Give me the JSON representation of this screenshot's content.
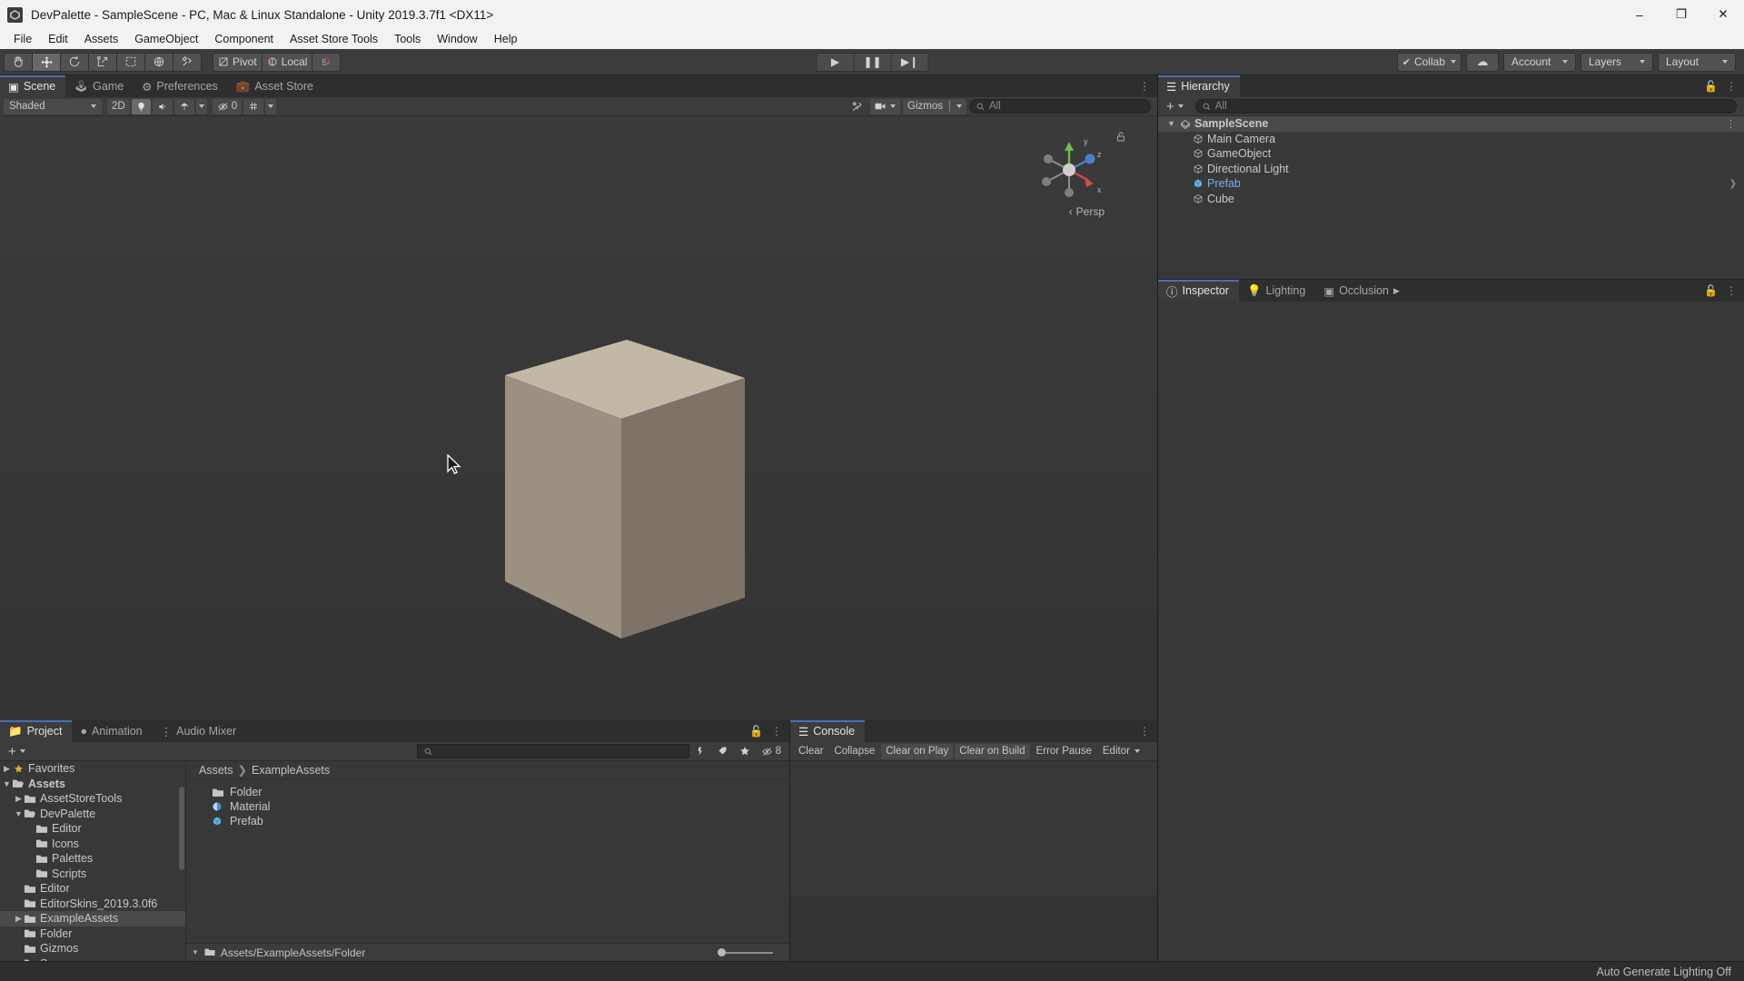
{
  "window": {
    "title": "DevPalette - SampleScene - PC, Mac & Linux Standalone - Unity 2019.3.7f1 <DX11>",
    "minimize": "–",
    "maximize": "❐",
    "close": "✕"
  },
  "menubar": {
    "items": [
      "File",
      "Edit",
      "Assets",
      "GameObject",
      "Component",
      "Asset Store Tools",
      "Tools",
      "Window",
      "Help"
    ]
  },
  "toolbar": {
    "tools": [
      {
        "name": "hand-tool",
        "glyph": "✋",
        "active": false
      },
      {
        "name": "move-tool",
        "glyph": "✥",
        "active": true
      },
      {
        "name": "rotate-tool",
        "glyph": "↻",
        "active": false
      },
      {
        "name": "scale-tool",
        "glyph": "⤡",
        "active": false
      },
      {
        "name": "rect-tool",
        "glyph": "⬚",
        "active": false
      },
      {
        "name": "transform-tool",
        "glyph": "⌖",
        "active": false
      },
      {
        "name": "custom-tool",
        "glyph": "⚒",
        "active": false
      }
    ],
    "pivot_label": "Pivot",
    "local_label": "Local",
    "grid_label": "",
    "play_label": "▶",
    "pause_label": "❚❚",
    "step_label": "▶❙",
    "collab_label": "Collab",
    "cloud_label": "☁",
    "account_label": "Account",
    "layers_label": "Layers",
    "layout_label": "Layout"
  },
  "scene_panel": {
    "tabs": [
      {
        "label": "Scene",
        "icon": "grid-icon",
        "active": true
      },
      {
        "label": "Game",
        "icon": "gamepad-icon",
        "active": false
      },
      {
        "label": "Preferences",
        "icon": "gear-icon",
        "active": false
      },
      {
        "label": "Asset Store",
        "icon": "store-icon",
        "active": false
      }
    ],
    "shading": "Shaded",
    "mode_2d": "2D",
    "lighting_icon": "💡",
    "audio_icon": "🔊",
    "fx_icon": "☂",
    "visibility_count": "0",
    "grid_icon": "⌗",
    "gizmos_label": "Gizmos",
    "search_placeholder": "All",
    "persp_label": "Persp",
    "gizmo_axes": {
      "x": "x",
      "y": "y",
      "z": "z"
    }
  },
  "hierarchy": {
    "title": "Hierarchy",
    "add_label": "+",
    "search_placeholder": "All",
    "items": [
      {
        "label": "SampleScene",
        "icon": "scene-icon",
        "depth": 0,
        "selected": true,
        "expanded": true,
        "menu": true
      },
      {
        "label": "Main Camera",
        "icon": "gameobject-icon",
        "depth": 1,
        "selected": false
      },
      {
        "label": "GameObject",
        "icon": "gameobject-icon",
        "depth": 1,
        "selected": false
      },
      {
        "label": "Directional Light",
        "icon": "gameobject-icon",
        "depth": 1,
        "selected": false
      },
      {
        "label": "Prefab",
        "icon": "prefab-icon",
        "depth": 1,
        "selected": false,
        "prefab": true,
        "chevron": true
      },
      {
        "label": "Cube",
        "icon": "gameobject-icon",
        "depth": 1,
        "selected": false
      }
    ]
  },
  "inspector": {
    "tabs": [
      {
        "label": "Inspector",
        "icon": "info-icon",
        "active": true
      },
      {
        "label": "Lighting",
        "icon": "bulb-icon",
        "active": false
      },
      {
        "label": "Occlusion",
        "icon": "occlusion-icon",
        "active": false
      }
    ]
  },
  "project": {
    "tabs": [
      {
        "label": "Project",
        "icon": "folder-icon",
        "active": true
      },
      {
        "label": "Animation",
        "icon": "clock-icon",
        "active": false
      },
      {
        "label": "Audio Mixer",
        "icon": "mixer-icon",
        "active": false
      }
    ],
    "add_label": "+",
    "search_placeholder": "",
    "filter_count": "8",
    "tree": [
      {
        "label": "Favorites",
        "depth": 0,
        "arrow": "collapsed",
        "star": true
      },
      {
        "label": "Assets",
        "depth": 0,
        "arrow": "expanded",
        "bold": true
      },
      {
        "label": "AssetStoreTools",
        "depth": 1,
        "arrow": "collapsed"
      },
      {
        "label": "DevPalette",
        "depth": 1,
        "arrow": "expanded"
      },
      {
        "label": "Editor",
        "depth": 2,
        "arrow": "none"
      },
      {
        "label": "Icons",
        "depth": 2,
        "arrow": "none"
      },
      {
        "label": "Palettes",
        "depth": 2,
        "arrow": "none"
      },
      {
        "label": "Scripts",
        "depth": 2,
        "arrow": "none"
      },
      {
        "label": "Editor",
        "depth": 1,
        "arrow": "none"
      },
      {
        "label": "EditorSkins_2019.3.0f6",
        "depth": 1,
        "arrow": "none"
      },
      {
        "label": "ExampleAssets",
        "depth": 1,
        "arrow": "collapsed",
        "selected": true
      },
      {
        "label": "Folder",
        "depth": 1,
        "arrow": "none"
      },
      {
        "label": "Gizmos",
        "depth": 1,
        "arrow": "none"
      },
      {
        "label": "Scenes",
        "depth": 1,
        "arrow": "none"
      }
    ],
    "breadcrumb": [
      "Assets",
      "ExampleAssets"
    ],
    "assets": [
      {
        "label": "Folder",
        "icon": "folder-icon"
      },
      {
        "label": "Material",
        "icon": "material-icon"
      },
      {
        "label": "Prefab",
        "icon": "prefab-icon"
      }
    ],
    "footer_path": "Assets/ExampleAssets/Folder"
  },
  "console": {
    "tabs": [
      {
        "label": "Console",
        "icon": "console-icon",
        "active": true
      }
    ],
    "buttons": [
      "Clear",
      "Collapse",
      "Clear on Play",
      "Clear on Build",
      "Error Pause"
    ],
    "editor_label": "Editor"
  },
  "statusbar": {
    "message": "Auto Generate Lighting Off"
  },
  "colors": {
    "accent_blue": "#4b6eaf",
    "prefab_blue": "#7aacec",
    "panel_bg": "#383838",
    "toolbar_bg": "#3c3c3c",
    "axis_x": "#d14b4b",
    "axis_y": "#6ac04a",
    "axis_z": "#4b7fd1"
  }
}
